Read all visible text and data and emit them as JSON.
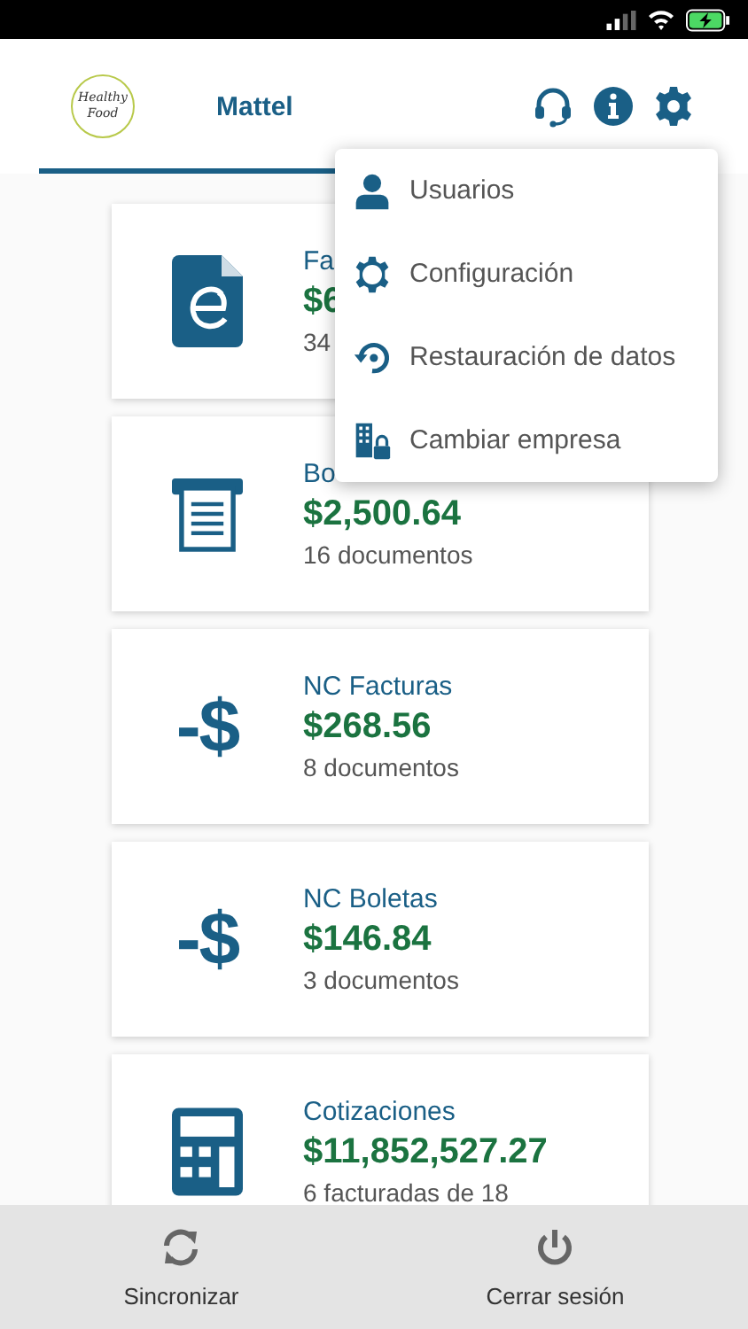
{
  "header": {
    "company": "Mattel",
    "logo": {
      "line_1": "Healthy",
      "line_2": "Food"
    }
  },
  "cards": [
    {
      "kind": "edoc",
      "title": "Fa",
      "amount": "$6",
      "detail": "34"
    },
    {
      "kind": "receipt",
      "title": "Bo",
      "amount": "$2,500.64",
      "detail": "16 documentos"
    },
    {
      "kind": "glyph",
      "glyph": "-$",
      "title": "NC Facturas",
      "amount": "$268.56",
      "detail": "8 documentos"
    },
    {
      "kind": "glyph",
      "glyph": "-$",
      "title": "NC Boletas",
      "amount": "$146.84",
      "detail": "3 documentos"
    },
    {
      "kind": "calculator",
      "title": "Cotizaciones",
      "amount": "$11,852,527.27",
      "detail": "6 facturadas de 18"
    }
  ],
  "menu": [
    {
      "kind": "user",
      "label": "Usuarios"
    },
    {
      "kind": "gear",
      "label": "Configuración"
    },
    {
      "kind": "restore",
      "label": "Restauración de datos"
    },
    {
      "kind": "building",
      "label": "Cambiar empresa"
    }
  ],
  "footer": [
    {
      "kind": "sync",
      "label": "Sincronizar"
    },
    {
      "kind": "power",
      "label": "Cerrar sesión"
    }
  ]
}
